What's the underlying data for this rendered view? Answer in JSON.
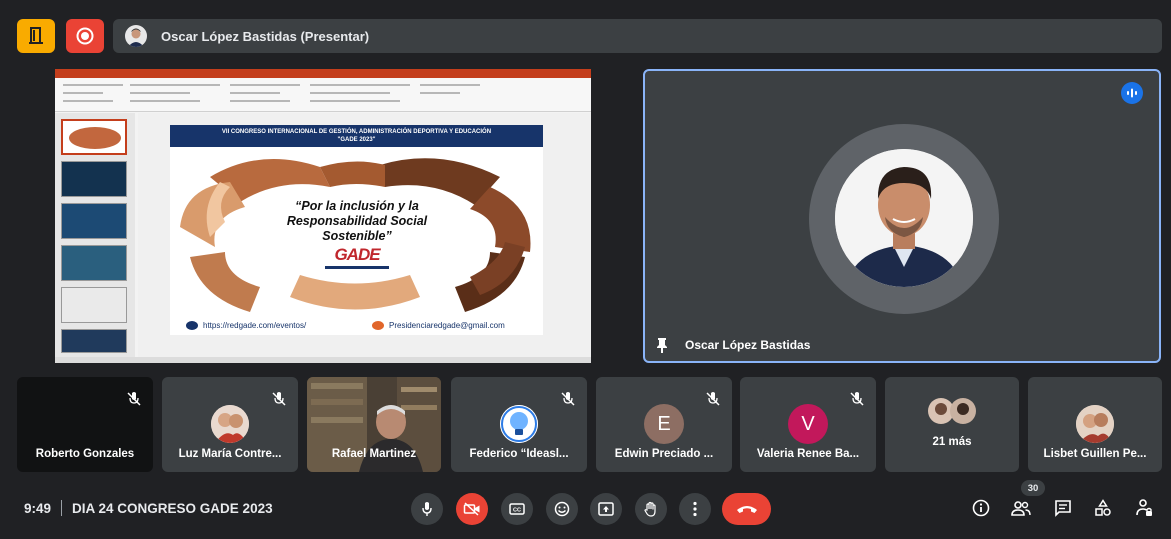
{
  "header": {
    "presenter_label": "Oscar López Bastidas (Presentar)"
  },
  "slide": {
    "header_line1": "VII CONGRESO INTERNACIONAL DE GESTIÓN, ADMINISTRACIÓN DEPORTIVA Y EDUCACIÓN",
    "header_line2": "\"GADE 2023\"",
    "slogan": "“Por la inclusión y la Responsabilidad Social Sostenible”",
    "logo_text": "GADE",
    "website": "https://redgade.com/eventos/",
    "email": "Presidenciaredgade@gmail.com"
  },
  "speaker": {
    "name": "Oscar López Bastidas"
  },
  "participants": [
    {
      "name": "Roberto Gonzales",
      "muted": true,
      "kind": "none"
    },
    {
      "name": "Luz María Contre...",
      "muted": true,
      "kind": "photo"
    },
    {
      "name": "Rafael Martinez",
      "muted": false,
      "kind": "video"
    },
    {
      "name": "Federico “Ideasl...",
      "muted": true,
      "kind": "photo"
    },
    {
      "name": "Edwin Preciado ...",
      "muted": true,
      "kind": "letter",
      "letter": "E",
      "color": "#8d6e63"
    },
    {
      "name": "Valeria Renee Ba...",
      "muted": true,
      "kind": "letter",
      "letter": "V",
      "color": "#c2185b"
    },
    {
      "name": "21 más",
      "muted": false,
      "kind": "group"
    },
    {
      "name": "Lisbet Guillen Pe...",
      "muted": false,
      "kind": "photo"
    }
  ],
  "footer": {
    "time": "9:49",
    "meeting_title": "DIA 24 CONGRESO GADE 2023",
    "participant_count": "30"
  },
  "colors": {
    "background": "#202124",
    "tile": "#3c4043",
    "active_border": "#8ab4f8",
    "danger": "#ea4335",
    "warning": "#f9ab00",
    "accent": "#1a73e8"
  },
  "icons": {
    "top_left": "door-icon",
    "record": "record-icon",
    "mic": "mic-icon",
    "camera_off": "camera-off-icon",
    "captions": "captions-icon",
    "emoji": "emoji-icon",
    "present": "present-icon",
    "hand": "raise-hand-icon",
    "more": "more-vert-icon",
    "hangup": "hangup-icon",
    "info": "info-icon",
    "people": "people-icon",
    "chat": "chat-icon",
    "activities": "activities-icon",
    "host": "host-controls-icon"
  }
}
